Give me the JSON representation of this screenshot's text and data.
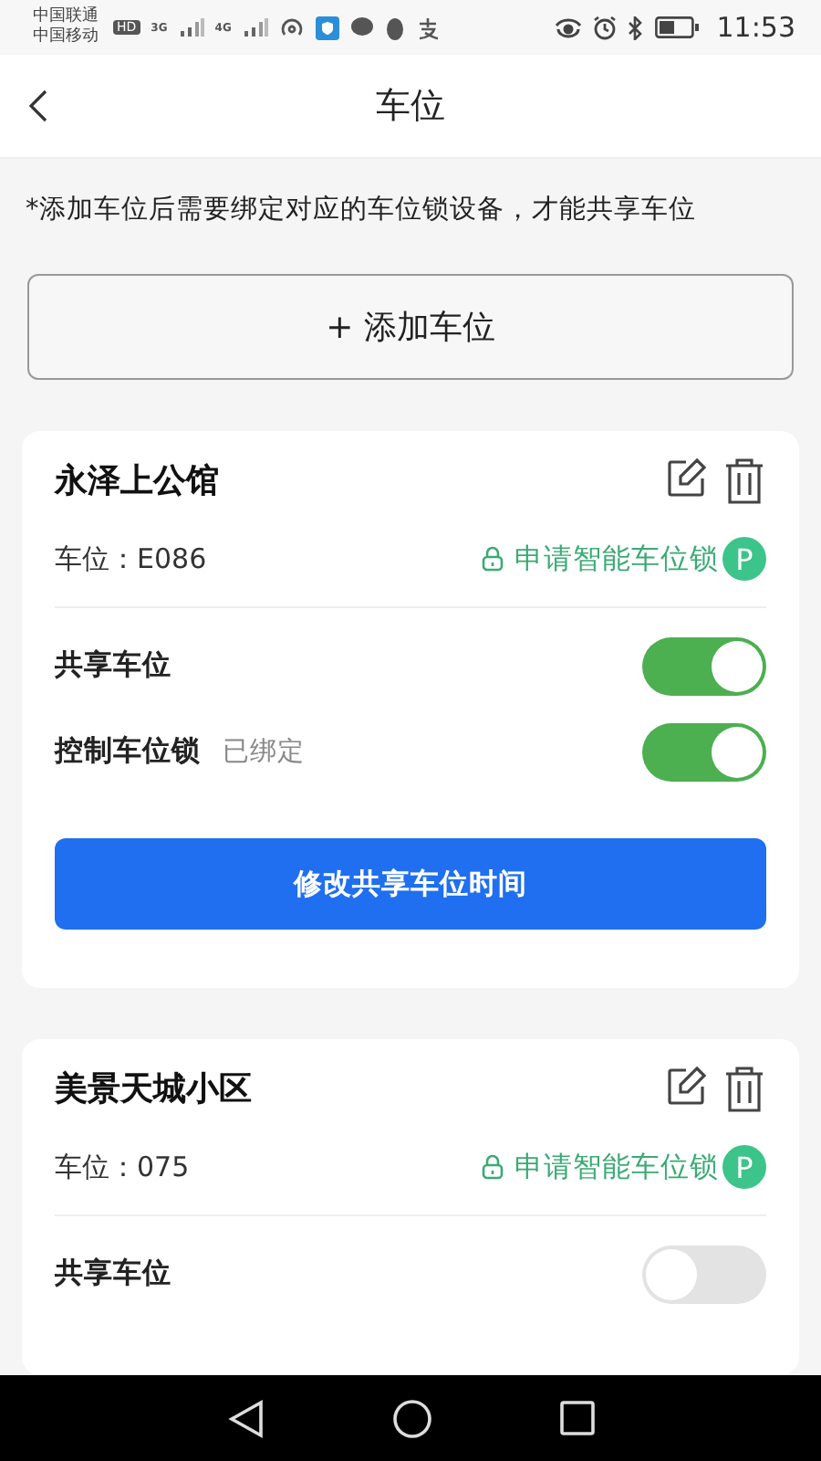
{
  "status_bar": {
    "carriers": [
      "中国联通",
      "中国移动"
    ],
    "hd": "HD",
    "networks": [
      "3G",
      "4G"
    ],
    "time": "11:53"
  },
  "header": {
    "title": "车位"
  },
  "notice": "*添加车位后需要绑定对应的车位锁设备，才能共享车位",
  "add_button": {
    "label": "+ 添加车位"
  },
  "spaces": [
    {
      "name": "永泽上公馆",
      "space": "车位：E086",
      "apply_link": "申请智能车位锁",
      "badge": "P",
      "settings": [
        {
          "label": "共享车位",
          "on": true
        },
        {
          "label": "控制车位锁",
          "status": "已绑定",
          "on": true
        }
      ],
      "action": "修改共享车位时间"
    },
    {
      "name": "美景天城小区",
      "space": "车位：075",
      "apply_link": "申请智能车位锁",
      "badge": "P",
      "settings": [
        {
          "label": "共享车位",
          "on": false
        }
      ]
    }
  ]
}
